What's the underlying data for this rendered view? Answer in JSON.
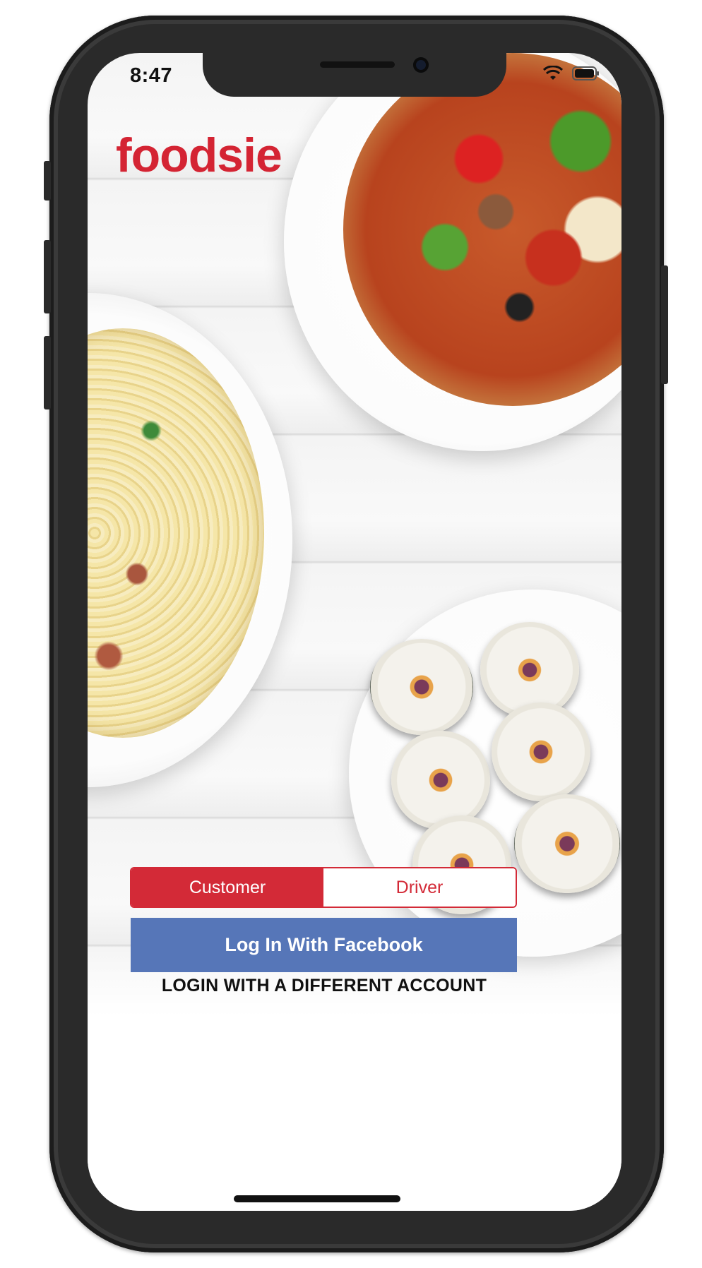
{
  "status_bar": {
    "time": "8:47"
  },
  "brand": {
    "name": "foodsie",
    "color": "#d42433"
  },
  "role_toggle": {
    "options": [
      "Customer",
      "Driver"
    ],
    "selected": "Customer",
    "accent": "#d32a37"
  },
  "facebook_button": {
    "label": "Log In With Facebook",
    "color": "#5676b8"
  },
  "alternate_login": {
    "label": "LOGIN WITH A DIFFERENT ACCOUNT"
  },
  "background_images": [
    "pizza-image",
    "pasta-image",
    "sushi-image"
  ]
}
